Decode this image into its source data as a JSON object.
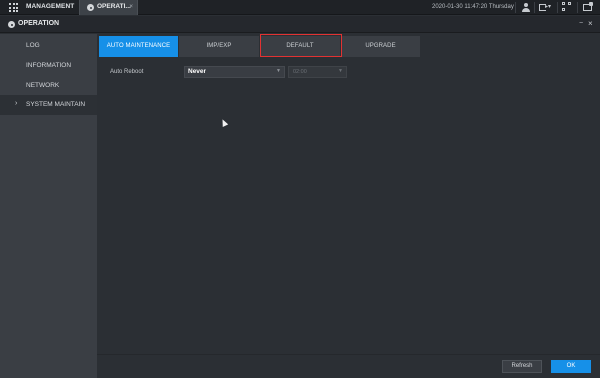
{
  "topbar": {
    "menu_label": "MANAGEMENT",
    "tab_label": "OPERATI...",
    "tab_close": "×",
    "datetime": "2020-01-30 11:47:20 Thursday",
    "icons": [
      "grid-icon",
      "user-icon",
      "exit-icon",
      "qr-code-icon",
      "alarm-monitor-icon"
    ]
  },
  "titlebar": {
    "title": "OPERATION",
    "minimize": "−",
    "close": "×"
  },
  "sidebar": {
    "items": [
      {
        "label": "LOG",
        "active": false
      },
      {
        "label": "INFORMATION",
        "active": false
      },
      {
        "label": "NETWORK",
        "active": false
      },
      {
        "label": "SYSTEM MAINTAIN",
        "active": true
      }
    ]
  },
  "tabs": [
    {
      "label": "AUTO MAINTENANCE",
      "active": true
    },
    {
      "label": "IMP/EXP",
      "active": false
    },
    {
      "label": "DEFAULT",
      "active": false,
      "highlighted": true
    },
    {
      "label": "UPGRADE",
      "active": false
    }
  ],
  "form": {
    "auto_reboot_label": "Auto Reboot",
    "auto_reboot_value": "Never",
    "time_value": "02:00"
  },
  "buttons": {
    "refresh": "Refresh",
    "ok": "OK"
  },
  "colors": {
    "accent": "#1690e8",
    "highlight_box": "#e23232"
  }
}
